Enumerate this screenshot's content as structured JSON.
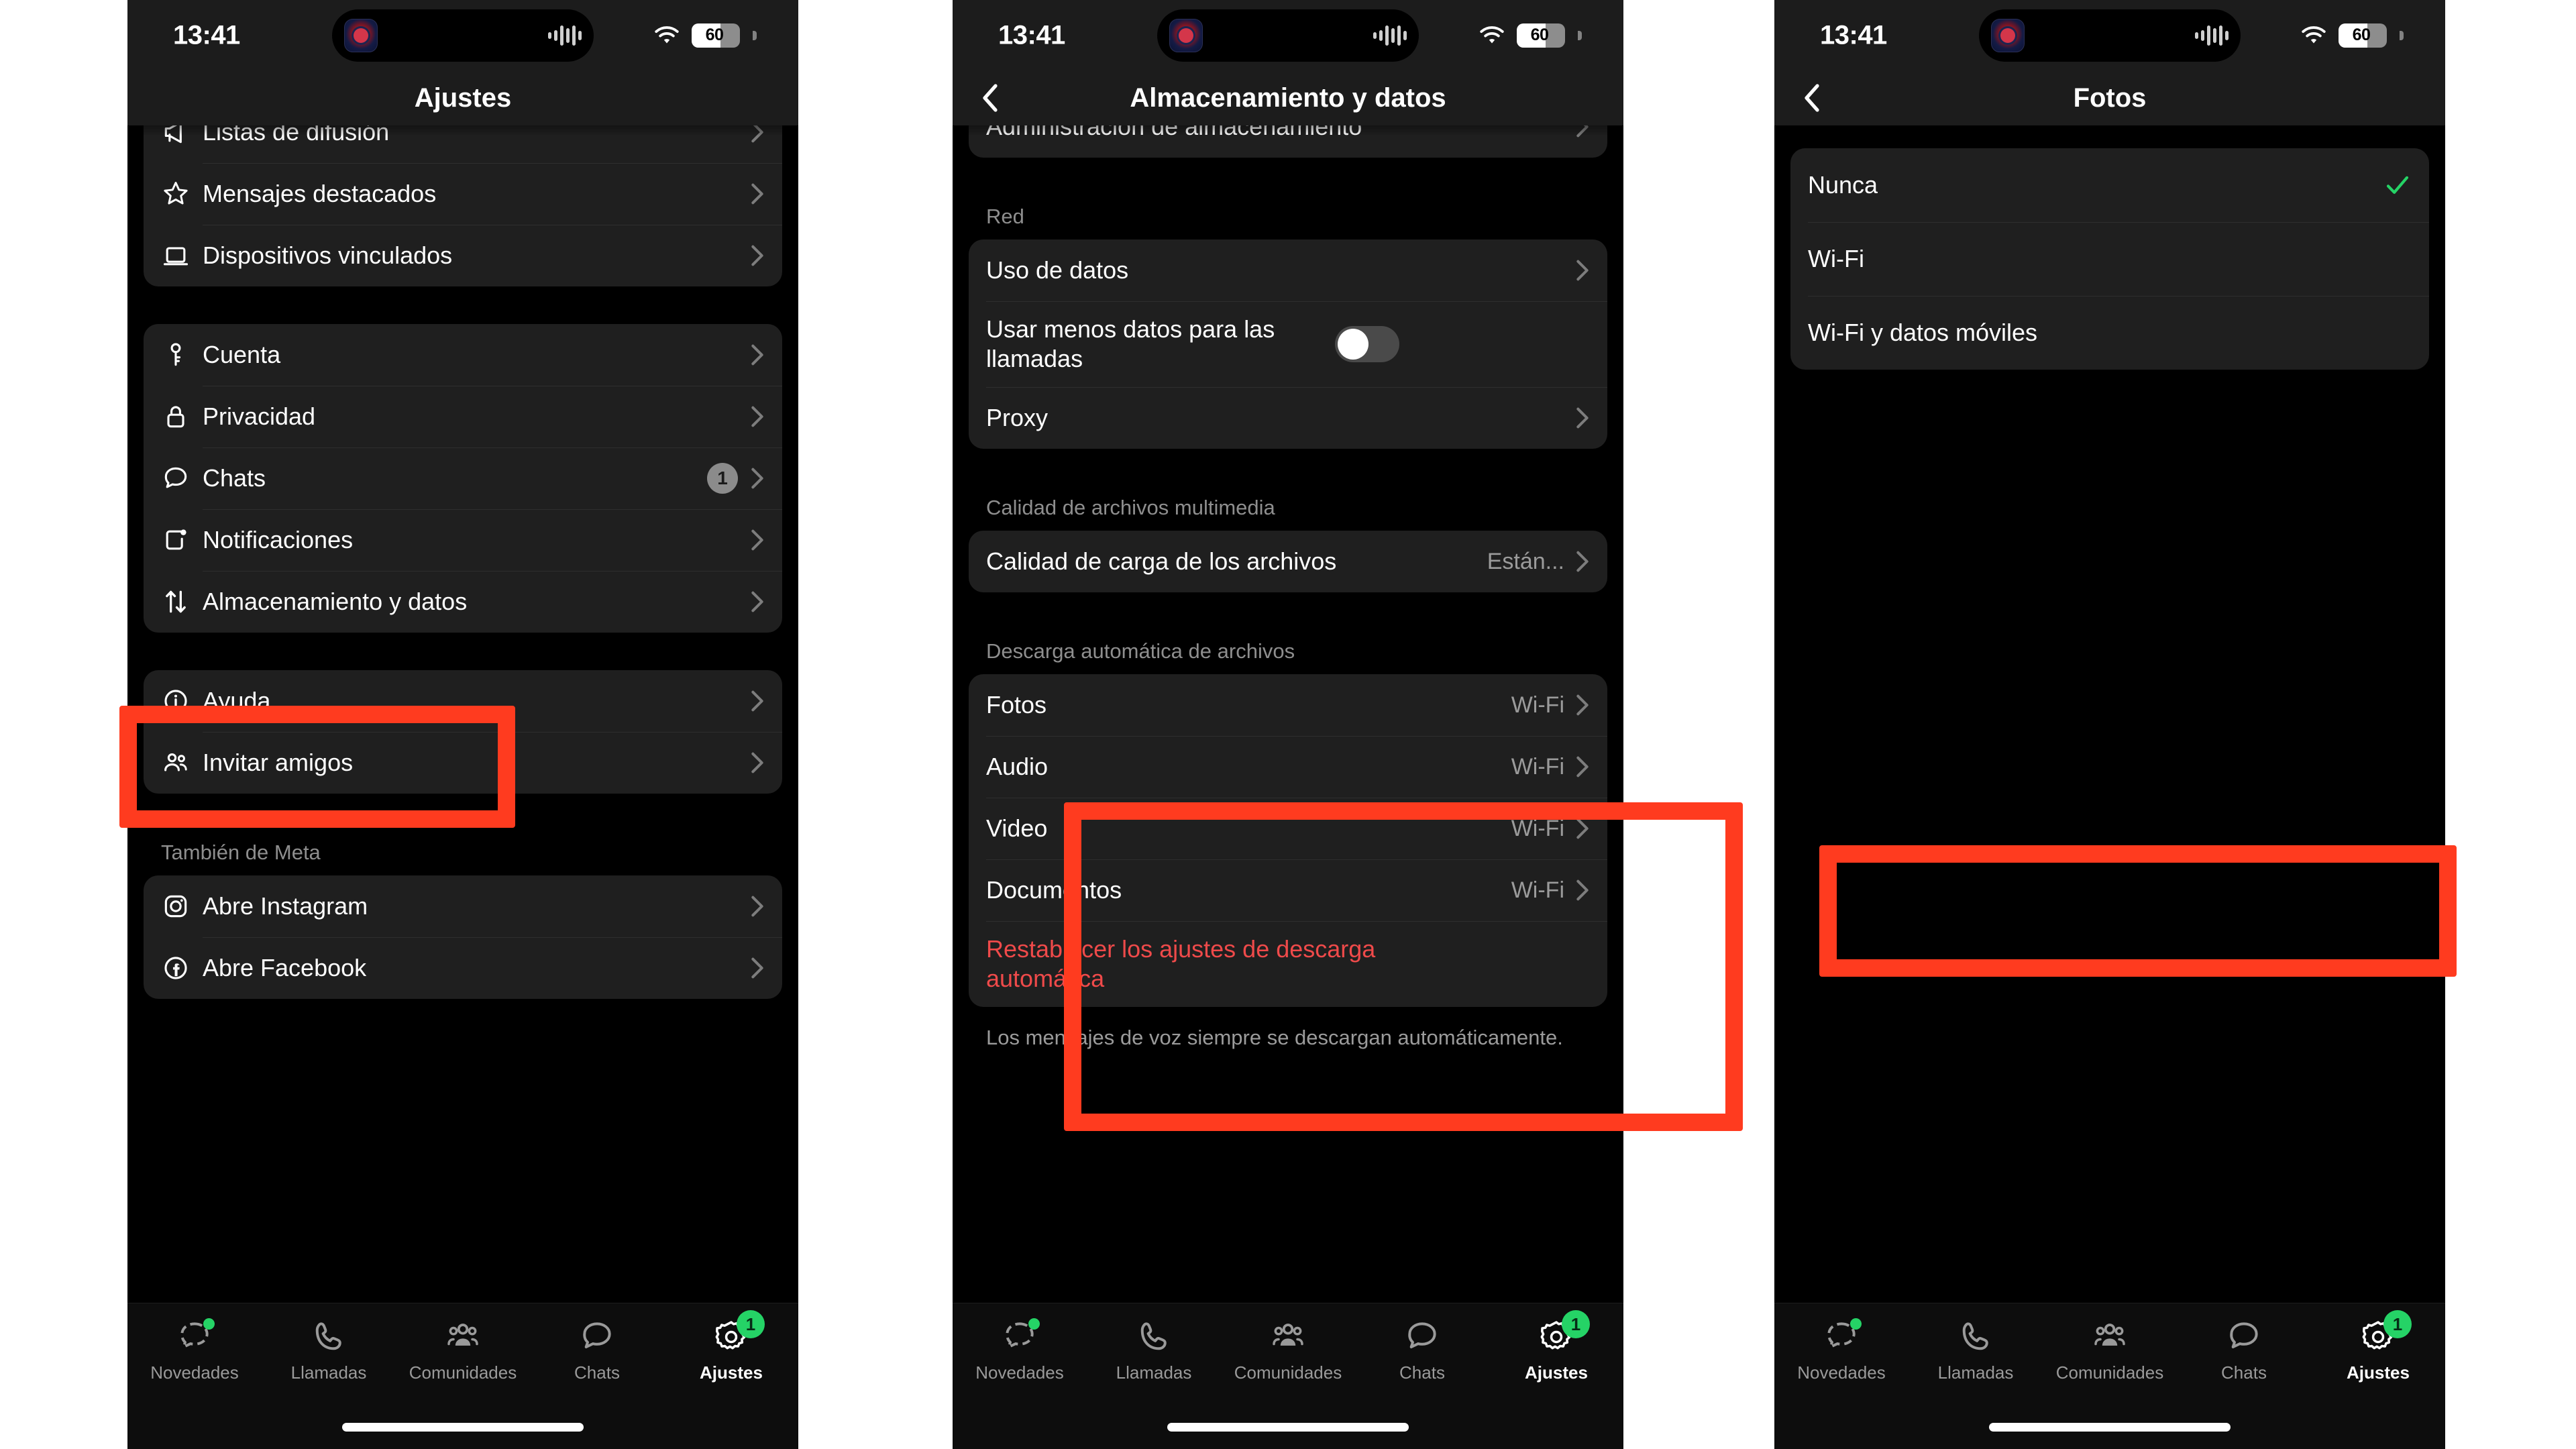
{
  "status_bar": {
    "time": "13:41",
    "battery_level": "60",
    "battery_percent": 60,
    "wifi_icon": "wifi-icon",
    "island_app_icon": "app-icon",
    "island_audio_icon": "audio-waveform-icon"
  },
  "colors": {
    "accent_green": "#25d366",
    "annotation_red": "#ff3b1f",
    "destructive_red": "#ef4a4a",
    "panel_bg": "#1f1f1f",
    "screen_bg": "#000000"
  },
  "tabbar": {
    "items": [
      {
        "label": "Novedades",
        "icon": "updates-icon",
        "active": false,
        "dot": true
      },
      {
        "label": "Llamadas",
        "icon": "phone-icon",
        "active": false,
        "dot": false
      },
      {
        "label": "Comunidades",
        "icon": "communities-icon",
        "active": false,
        "dot": false
      },
      {
        "label": "Chats",
        "icon": "chat-bubble-icon",
        "active": false,
        "dot": false
      },
      {
        "label": "Ajustes",
        "icon": "gear-icon",
        "active": true,
        "badge": "1"
      }
    ]
  },
  "screen1": {
    "title": "Ajustes",
    "groups": {
      "g1": [
        {
          "label": "Listas de difusión",
          "icon": "megaphone-icon"
        },
        {
          "label": "Mensajes destacados",
          "icon": "star-icon"
        },
        {
          "label": "Dispositivos vinculados",
          "icon": "laptop-icon"
        }
      ],
      "g2": [
        {
          "label": "Cuenta",
          "icon": "key-icon"
        },
        {
          "label": "Privacidad",
          "icon": "lock-icon"
        },
        {
          "label": "Chats",
          "icon": "chat-bubble-icon",
          "badge": "1"
        },
        {
          "label": "Notificaciones",
          "icon": "notification-icon"
        },
        {
          "label": "Almacenamiento y datos",
          "icon": "arrows-updown-icon",
          "highlighted": true
        }
      ],
      "g3": [
        {
          "label": "Ayuda",
          "icon": "info-icon"
        },
        {
          "label": "Invitar amigos",
          "icon": "people-icon"
        }
      ],
      "meta_header": "También de Meta",
      "g4": [
        {
          "label": "Abre Instagram",
          "icon": "instagram-icon"
        },
        {
          "label": "Abre Facebook",
          "icon": "facebook-icon"
        }
      ]
    }
  },
  "screen2": {
    "title": "Almacenamiento y datos",
    "back_icon": "chevron-left-icon",
    "storage_row": {
      "label": "Administración de almacenamiento"
    },
    "network_header": "Red",
    "network_rows": [
      {
        "label": "Uso de datos",
        "type": "link"
      },
      {
        "label": "Usar menos datos para las llamadas",
        "type": "toggle",
        "value": "off"
      },
      {
        "label": "Proxy",
        "type": "link"
      }
    ],
    "quality_header": "Calidad de archivos multimedia",
    "quality_row": {
      "label": "Calidad de carga de los archivos",
      "value": "Están..."
    },
    "autodownload_header": "Descarga automática de archivos",
    "autodownload_rows": [
      {
        "label": "Fotos",
        "value": "Wi-Fi"
      },
      {
        "label": "Audio",
        "value": "Wi-Fi"
      },
      {
        "label": "Video",
        "value": "Wi-Fi"
      },
      {
        "label": "Documentos",
        "value": "Wi-Fi"
      }
    ],
    "reset_label": "Restablecer los ajustes de descarga automática",
    "footnote": "Los mensajes de voz siempre se descargan automáticamente."
  },
  "screen3": {
    "title": "Fotos",
    "back_icon": "chevron-left-icon",
    "options": [
      {
        "label": "Nunca",
        "selected": true,
        "highlighted": true
      },
      {
        "label": "Wi-Fi",
        "selected": false
      },
      {
        "label": "Wi-Fi y datos móviles",
        "selected": false
      }
    ]
  }
}
